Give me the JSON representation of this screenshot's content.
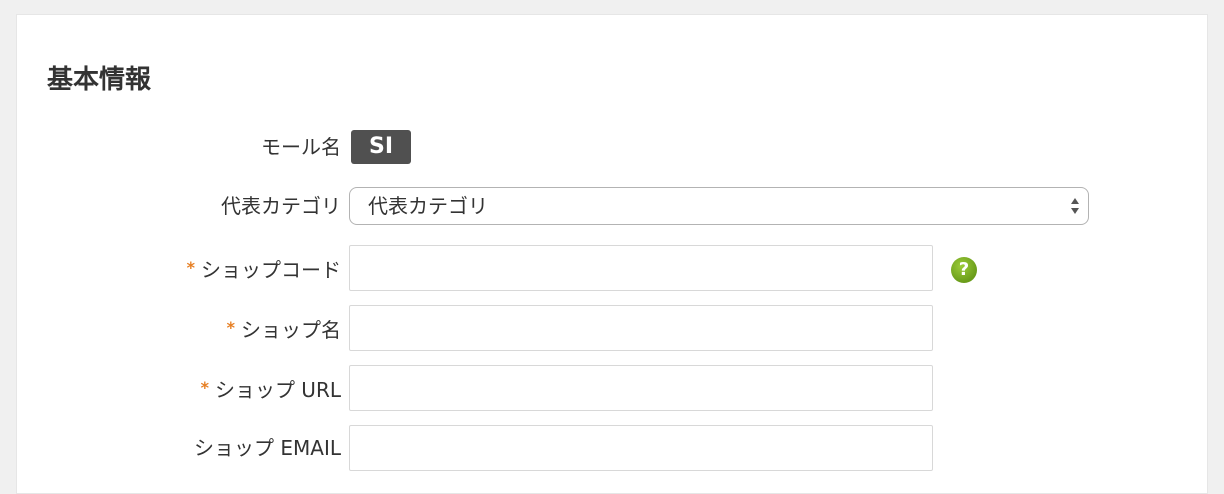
{
  "section": {
    "title": "基本情報"
  },
  "fields": {
    "mall": {
      "label": "モール名",
      "badge": "SI"
    },
    "category": {
      "label": "代表カテゴリ",
      "selected": "代表カテゴリ"
    },
    "shop_code": {
      "required_mark": "*",
      "label": "ショップコード",
      "value": "",
      "help_icon": "question-circle-icon"
    },
    "shop_name": {
      "required_mark": "*",
      "label": "ショップ名",
      "value": ""
    },
    "shop_url": {
      "required_mark": "*",
      "label": "ショップ URL",
      "value": ""
    },
    "shop_email": {
      "label": "ショップ EMAIL",
      "value": ""
    }
  },
  "colors": {
    "required": "#e67e22",
    "badge_bg": "#505050",
    "help_icon": "#7cad22"
  }
}
